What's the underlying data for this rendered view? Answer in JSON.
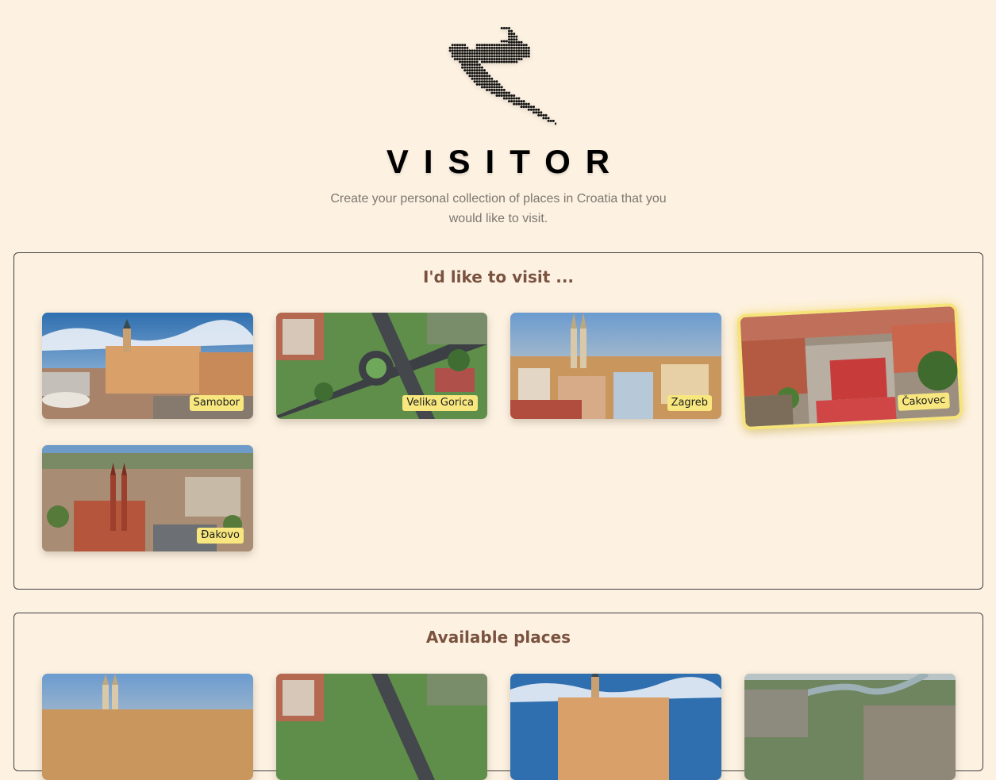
{
  "header": {
    "title": "VISITOR",
    "subtitle": "Create your personal collection of places in Croatia that you would like to visit.",
    "logo_icon": "croatia-dot-map-icon"
  },
  "visit_section": {
    "heading": "I'd like to visit ...",
    "places": [
      {
        "label": "Samobor",
        "active": false
      },
      {
        "label": "Velika Gorica",
        "active": false
      },
      {
        "label": "Zagreb",
        "active": false
      },
      {
        "label": "Čakovec",
        "active": true
      },
      {
        "label": "Đakovo",
        "active": false
      }
    ]
  },
  "available_section": {
    "heading": "Available places"
  },
  "colors": {
    "background": "#fdf2e2",
    "heading": "#7a5240",
    "label_bg": "#f7e77e",
    "active_glow": "#f6e47a"
  }
}
